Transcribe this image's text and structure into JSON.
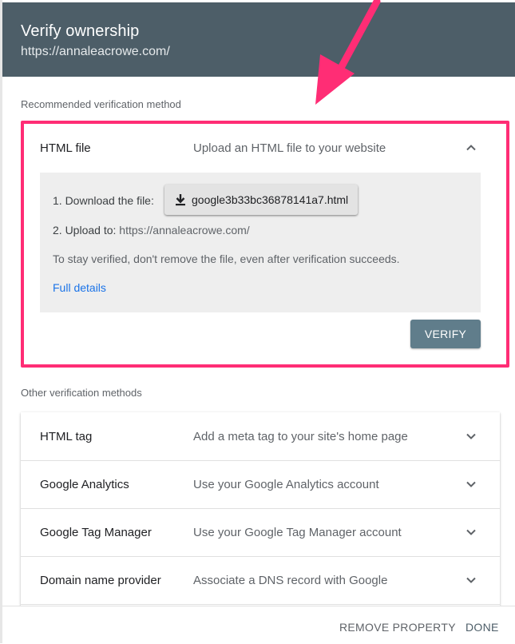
{
  "header": {
    "title": "Verify ownership",
    "url": "https://annaleacrowe.com/"
  },
  "recommended": {
    "label": "Recommended verification method",
    "method": {
      "title": "HTML file",
      "description": "Upload an HTML file to your website",
      "step1_label": "1. Download the file:",
      "download_file": "google3b33bc36878141a7.html",
      "step2_label": "2. Upload to:",
      "step2_url": "https://annaleacrowe.com/",
      "note": "To stay verified, don't remove the file, even after verification succeeds.",
      "full_details": "Full details",
      "verify_label": "VERIFY",
      "expanded": true
    }
  },
  "other": {
    "label": "Other verification methods",
    "methods": [
      {
        "title": "HTML tag",
        "description": "Add a meta tag to your site's home page"
      },
      {
        "title": "Google Analytics",
        "description": "Use your Google Analytics account"
      },
      {
        "title": "Google Tag Manager",
        "description": "Use your Google Tag Manager account"
      },
      {
        "title": "Domain name provider",
        "description": "Associate a DNS record with Google"
      }
    ]
  },
  "footer": {
    "remove_label": "REMOVE PROPERTY",
    "done_label": "DONE"
  },
  "icons": {
    "download": "download-icon",
    "chevron_up": "chevron-up-icon",
    "chevron_down": "chevron-down-icon",
    "annotation_arrow": "annotation-arrow-icon"
  },
  "colors": {
    "header_bg": "#4d5e68",
    "highlight_border": "#ff2d75",
    "verify_button": "#607d8b",
    "link": "#1a73e8"
  }
}
